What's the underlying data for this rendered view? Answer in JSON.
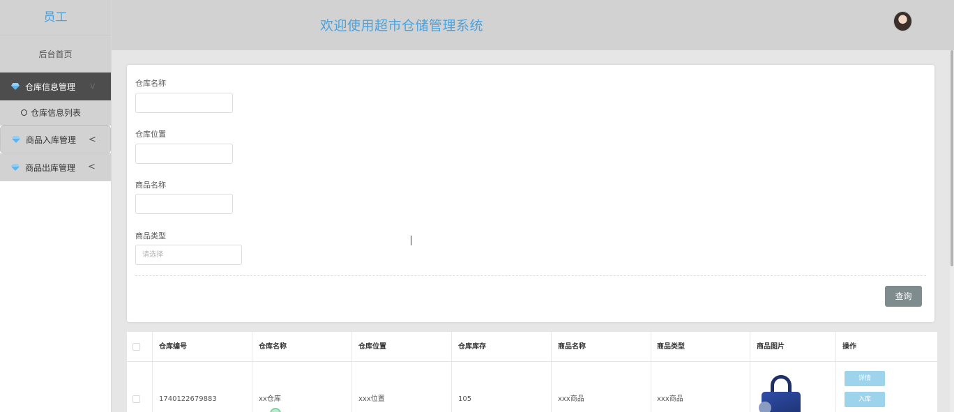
{
  "sidebar": {
    "brand": "员工",
    "home": "后台首页",
    "menus": [
      {
        "label": "仓库信息管理",
        "icon": "diamond-icon",
        "active": true,
        "sub": [
          {
            "label": "仓库信息列表",
            "icon": "circle-check-icon"
          }
        ]
      },
      {
        "label": "商品入库管理",
        "icon": "diamond-icon",
        "active": false
      },
      {
        "label": "商品出库管理",
        "icon": "diamond-icon",
        "active": false
      }
    ],
    "chevron": "<"
  },
  "header": {
    "title": "欢迎使用超市仓储管理系统",
    "avatar_icon": "user-avatar-icon"
  },
  "search": {
    "fields": [
      {
        "label": "仓库名称",
        "value": "",
        "placeholder": ""
      },
      {
        "label": "仓库位置",
        "value": "",
        "placeholder": ""
      },
      {
        "label": "商品名称",
        "value": "",
        "placeholder": ""
      },
      {
        "label": "商品类型",
        "value": "",
        "placeholder": "请选择"
      }
    ],
    "query_button": "查询"
  },
  "table": {
    "columns": [
      "仓库编号",
      "仓库名称",
      "仓库位置",
      "仓库库存",
      "商品名称",
      "商品类型",
      "商品图片",
      "操作"
    ],
    "rows": [
      {
        "id": "1740122679883",
        "warehouse_name": "xx仓库",
        "warehouse_location": "xxx位置",
        "stock": "105",
        "product_name": "xxx商品",
        "product_type": "xxx商品",
        "image_icon": "handbag-image",
        "actions": [
          "详情",
          "入库"
        ]
      }
    ]
  },
  "colors": {
    "accent": "#4aa3df",
    "sidebar_active": "#4d4d4d",
    "header_bg": "#d2d2d2",
    "query_button": "#7f8c8d",
    "action_button": "#9ed3ec"
  }
}
